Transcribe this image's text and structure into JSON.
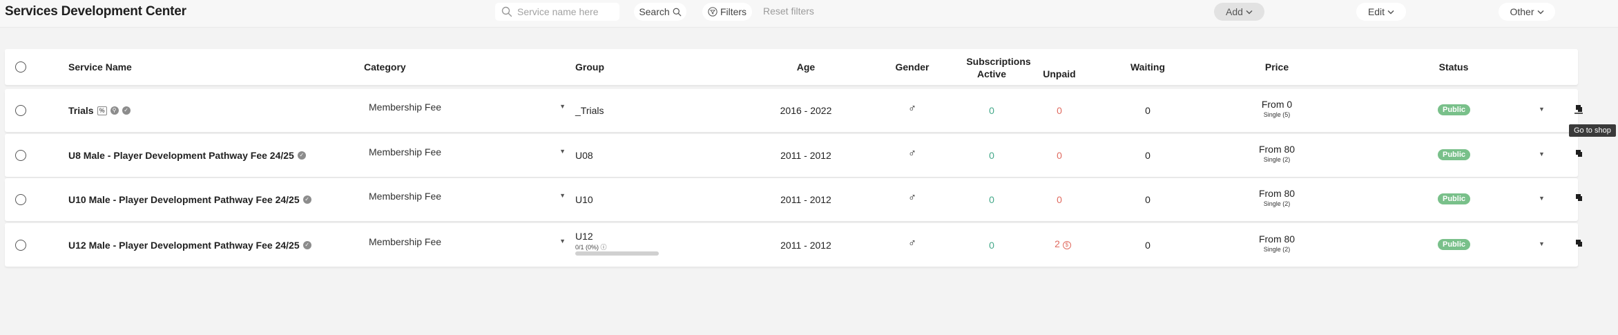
{
  "header": {
    "title": "Services Development Center",
    "search_placeholder": "Service name here",
    "search_label": "Search",
    "filters_label": "Filters",
    "reset_label": "Reset filters",
    "add_label": "Add",
    "edit_label": "Edit",
    "other_label": "Other"
  },
  "table": {
    "columns": {
      "service_name": "Service Name",
      "category": "Category",
      "group": "Group",
      "age": "Age",
      "gender": "Gender",
      "subscriptions": "Subscriptions",
      "active": "Active",
      "unpaid": "Unpaid",
      "waiting": "Waiting",
      "price": "Price",
      "status": "Status"
    },
    "rows": [
      {
        "name": "Trials",
        "pct_badge": "%",
        "category": "Membership Fee",
        "group": "_Trials",
        "age": "2016 - 2022",
        "gender": "♂",
        "active": "0",
        "unpaid": "0",
        "waiting": "0",
        "price": "From 0",
        "price_sub": "Single (5)",
        "status": "Public"
      },
      {
        "name": "U8 Male - Player Development Pathway Fee 24/25",
        "category": "Membership Fee",
        "group": "U08",
        "age": "2011 - 2012",
        "gender": "♂",
        "active": "0",
        "unpaid": "0",
        "waiting": "0",
        "price": "From 80",
        "price_sub": "Single (2)",
        "status": "Public"
      },
      {
        "name": "U10 Male - Player Development Pathway Fee 24/25",
        "category": "Membership Fee",
        "group": "U10",
        "age": "2011 - 2012",
        "gender": "♂",
        "active": "0",
        "unpaid": "0",
        "waiting": "0",
        "price": "From 80",
        "price_sub": "Single (2)",
        "status": "Public"
      },
      {
        "name": "U12 Male - Player Development Pathway Fee 24/25",
        "category": "Membership Fee",
        "group": "U12",
        "group_sub": "0/1 (0%)",
        "capacity_fill": 0,
        "age": "2011 - 2012",
        "gender": "♂",
        "active": "0",
        "unpaid": "2",
        "unpaid_icon": "$",
        "waiting": "0",
        "price": "From 80",
        "price_sub": "Single (2)",
        "status": "Public"
      }
    ]
  },
  "tooltip": "Go to shop",
  "colors": {
    "active": "#43a889",
    "unpaid": "#e06b60",
    "status_public": "#79c08a"
  },
  "icons": {
    "search": "search-icon",
    "filter": "filter-icon",
    "shop": "go-to-shop-icon",
    "chevron": "chevron-down-icon"
  }
}
